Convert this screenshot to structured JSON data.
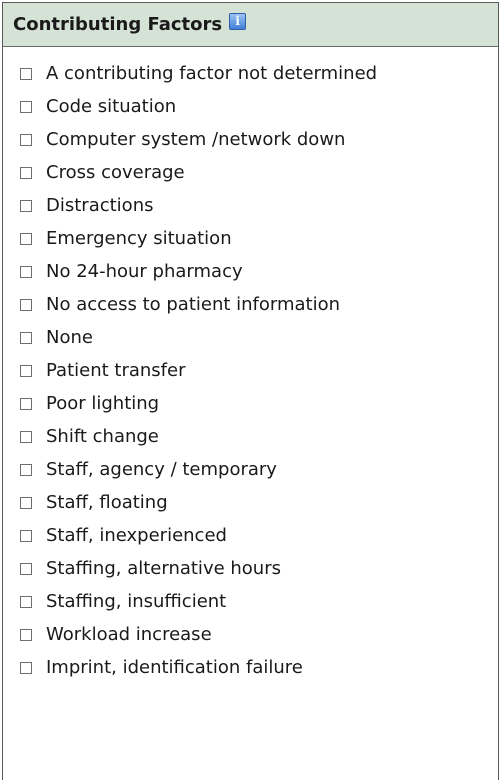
{
  "panel": {
    "title": "Contributing Factors",
    "info_icon": "info-icon",
    "info_icon_glyph": "i"
  },
  "factors": [
    {
      "label": "A contributing factor not determined",
      "checked": false
    },
    {
      "label": "Code situation",
      "checked": false
    },
    {
      "label": "Computer system /network down",
      "checked": false
    },
    {
      "label": "Cross coverage",
      "checked": false
    },
    {
      "label": "Distractions",
      "checked": false
    },
    {
      "label": "Emergency situation",
      "checked": false
    },
    {
      "label": "No 24-hour pharmacy",
      "checked": false
    },
    {
      "label": "No access to patient information",
      "checked": false
    },
    {
      "label": "None",
      "checked": false
    },
    {
      "label": "Patient transfer",
      "checked": false
    },
    {
      "label": "Poor lighting",
      "checked": false
    },
    {
      "label": "Shift change",
      "checked": false
    },
    {
      "label": "Staff, agency / temporary",
      "checked": false
    },
    {
      "label": "Staff, floating",
      "checked": false
    },
    {
      "label": "Staff, inexperienced",
      "checked": false
    },
    {
      "label": "Staffing, alternative hours",
      "checked": false
    },
    {
      "label": "Staffing, insufficient",
      "checked": false
    },
    {
      "label": "Workload increase",
      "checked": false
    },
    {
      "label": "Imprint, identification failure",
      "checked": false
    }
  ],
  "colors": {
    "header_bg": "#d5e2d6",
    "border": "#5a5a5a",
    "text": "#1a1a1a",
    "info_icon": "#3f7fd6"
  }
}
